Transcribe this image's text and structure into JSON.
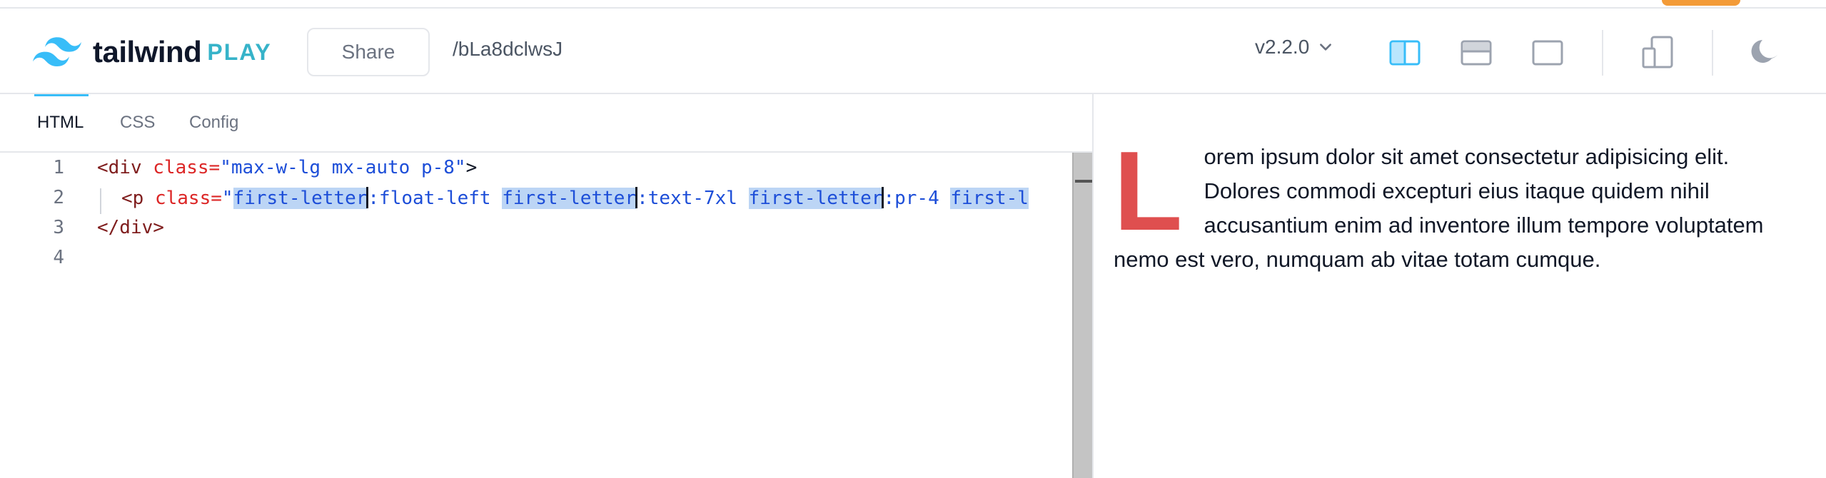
{
  "header": {
    "brand_word": "tailwind",
    "brand_suffix": "PLAY",
    "share_label": "Share",
    "share_path": "/bLa8dclwsJ",
    "version": "v2.2.0"
  },
  "tabs": [
    {
      "label": "HTML",
      "active": true
    },
    {
      "label": "CSS",
      "active": false
    },
    {
      "label": "Config",
      "active": false
    }
  ],
  "editor": {
    "line_numbers": [
      "1",
      "2",
      "3",
      "4"
    ],
    "line1": {
      "open": "<div",
      "attr": " class=",
      "value": "\"max-w-lg mx-auto p-8\"",
      "close": ">"
    },
    "line2": {
      "open": "<p",
      "attr": " class=",
      "quote": "\"",
      "token1": "first-letter",
      "rest1": ":float-left ",
      "token2": "first-letter",
      "rest2": ":text-7xl ",
      "token3": "first-letter",
      "rest3": ":pr-4 ",
      "token4": "first-l"
    },
    "line3": "</div>"
  },
  "preview": {
    "drop_cap": "L",
    "text": "orem ipsum dolor sit amet consectetur adipisicing elit. Dolores commodi excepturi eius itaque quidem nihil accusantium enim ad inventore illum tempore voluptatem nemo est vero, numquam ab vitae totam cumque."
  },
  "colors": {
    "accent": "#38bdf8",
    "drop_cap": "#df4f4f",
    "highlight": "#bcd5f5"
  }
}
